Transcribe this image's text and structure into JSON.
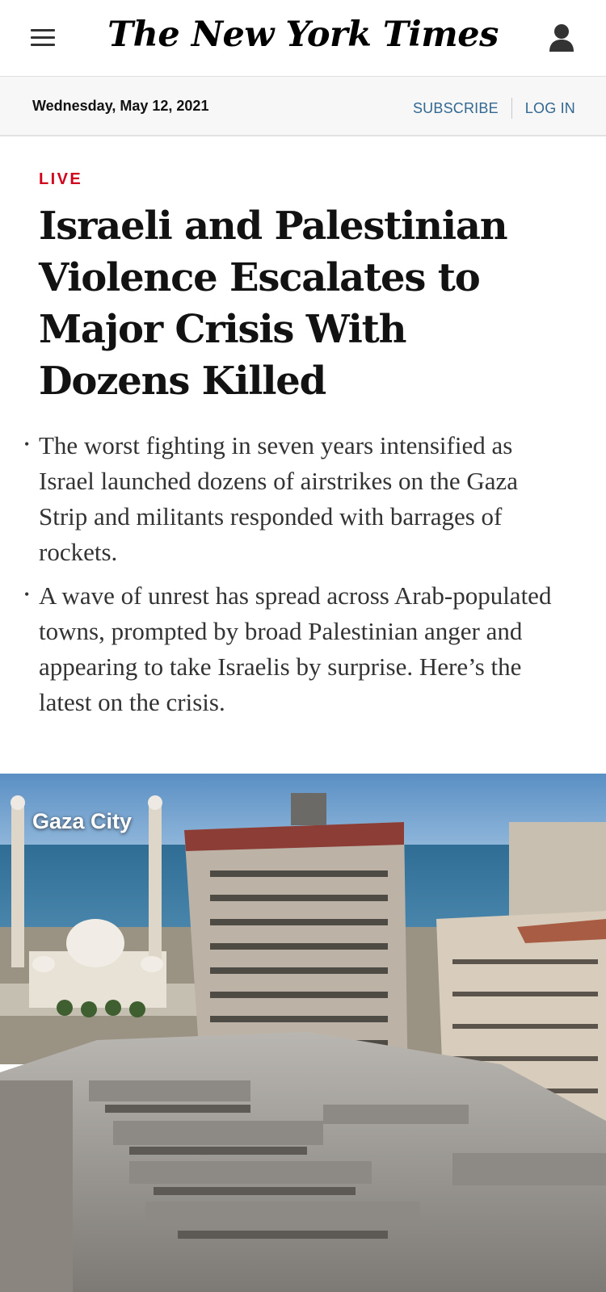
{
  "masthead": {
    "logo_text": "The New York Times",
    "menu_icon": "hamburger-menu-icon",
    "account_icon": "user-icon"
  },
  "datebar": {
    "date": "Wednesday, May 12, 2021",
    "subscribe_label": "SUBSCRIBE",
    "login_label": "LOG IN"
  },
  "article": {
    "kicker": "LIVE",
    "headline": "Israeli and Palestinian Violence Escalates to Major Crisis With Dozens Killed",
    "summary": [
      "The worst fighting in seven years intensified as Israel launched dozens of airstrikes on the Gaza Strip and militants responded with barrages of rockets.",
      "A wave of unrest has spread across Arab-populated towns, prompted by broad Palestinian anger and appearing to take Israelis by surprise. Here’s the latest on the crisis."
    ]
  },
  "photo": {
    "location_label": "Gaza City"
  },
  "colors": {
    "live_red": "#d0021b",
    "link_blue": "#326891",
    "datebar_bg": "#f7f7f7"
  }
}
